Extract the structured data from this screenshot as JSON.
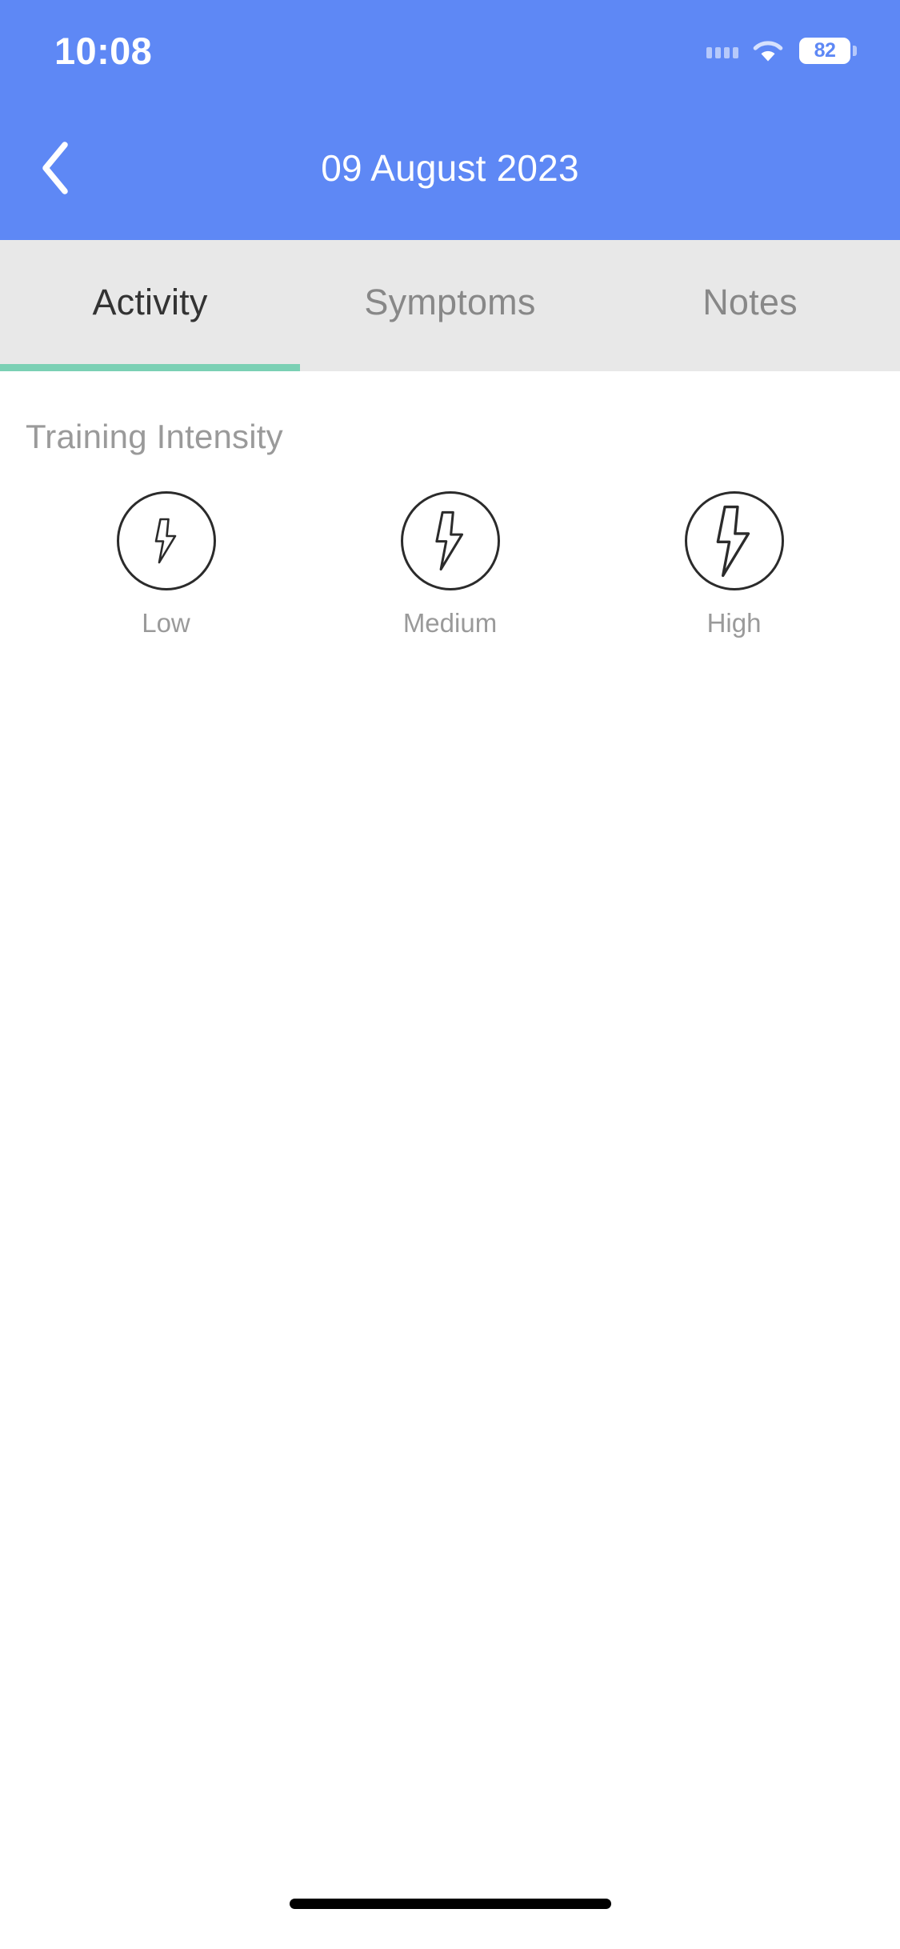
{
  "status_bar": {
    "time": "10:08",
    "battery_level": "82",
    "signal_icon": "signal-dots-icon",
    "wifi_icon": "wifi-icon",
    "battery_icon": "battery-icon"
  },
  "nav": {
    "back_icon": "chevron-left-icon",
    "title": "09 August 2023"
  },
  "tabs": {
    "items": [
      {
        "label": "Activity",
        "active": true
      },
      {
        "label": "Symptoms",
        "active": false
      },
      {
        "label": "Notes",
        "active": false
      }
    ],
    "active_index": 0,
    "indicator_color": "#7BD0B4"
  },
  "content": {
    "section_title": "Training Intensity",
    "intensity_options": [
      {
        "label": "Low",
        "icon": "lightning-bolt-icon",
        "bolt_scale": "small",
        "selected": false
      },
      {
        "label": "Medium",
        "icon": "lightning-bolt-icon",
        "bolt_scale": "medium",
        "selected": false
      },
      {
        "label": "High",
        "icon": "lightning-bolt-icon",
        "bolt_scale": "large",
        "selected": false
      }
    ]
  },
  "colors": {
    "header_blue": "#5E88F5",
    "tab_bar_bg": "#E8E8E8",
    "accent_green": "#7BD0B4",
    "muted_text": "#9A9A9A",
    "active_tab_text": "#333333",
    "outline_dark": "#2B2B2B"
  },
  "home_indicator": {
    "name": "home-indicator"
  }
}
